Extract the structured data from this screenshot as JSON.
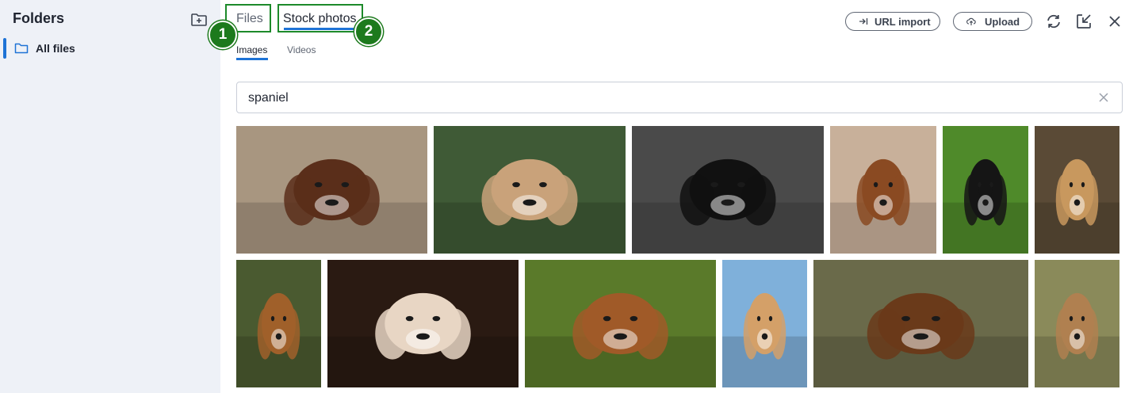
{
  "sidebar": {
    "title": "Folders",
    "folders": [
      {
        "label": "All files",
        "active": true
      }
    ]
  },
  "tabs": [
    {
      "label": "Files",
      "active": false
    },
    {
      "label": "Stock photos",
      "active": true
    }
  ],
  "annotations": [
    "1",
    "2"
  ],
  "subtabs": [
    {
      "label": "Images",
      "active": true
    },
    {
      "label": "Videos",
      "active": false
    }
  ],
  "actions": {
    "url_import": "URL import",
    "upload": "Upload"
  },
  "search": {
    "value": "spaniel"
  },
  "photos": [
    {
      "subject": "springer spaniel face closeup",
      "bg": "#a89680",
      "fg": "#5a2e1a"
    },
    {
      "subject": "couple with dogs on grass",
      "bg": "#3f5a36",
      "fg": "#c9a27a"
    },
    {
      "subject": "black tricolor cavalier lying down",
      "bg": "#4a4a4a",
      "fg": "#111111"
    },
    {
      "subject": "cavalier puppy on wood floor",
      "bg": "#c8b09a",
      "fg": "#8a4a22"
    },
    {
      "subject": "tricolor cavalier on grass",
      "bg": "#4f8a2a",
      "fg": "#151515"
    },
    {
      "subject": "golden cocker spaniel",
      "bg": "#5a4a36",
      "fg": "#c8985e"
    },
    {
      "subject": "spaniel under tree in forest",
      "bg": "#4a5a30",
      "fg": "#a0602a"
    },
    {
      "subject": "blenheim cavalier portrait dark",
      "bg": "#2a1a12",
      "fg": "#e8d6c4"
    },
    {
      "subject": "blenheim cavalier on grass",
      "bg": "#5a7a2a",
      "fg": "#a05a28"
    },
    {
      "subject": "cocker spaniel against sky",
      "bg": "#7fb0da",
      "fg": "#d4a068"
    },
    {
      "subject": "brown spaniel running by lake",
      "bg": "#6a6a4a",
      "fg": "#6a3a1a"
    },
    {
      "subject": "spaniel in tall grass hills",
      "bg": "#8a8a5a",
      "fg": "#b08050"
    }
  ]
}
